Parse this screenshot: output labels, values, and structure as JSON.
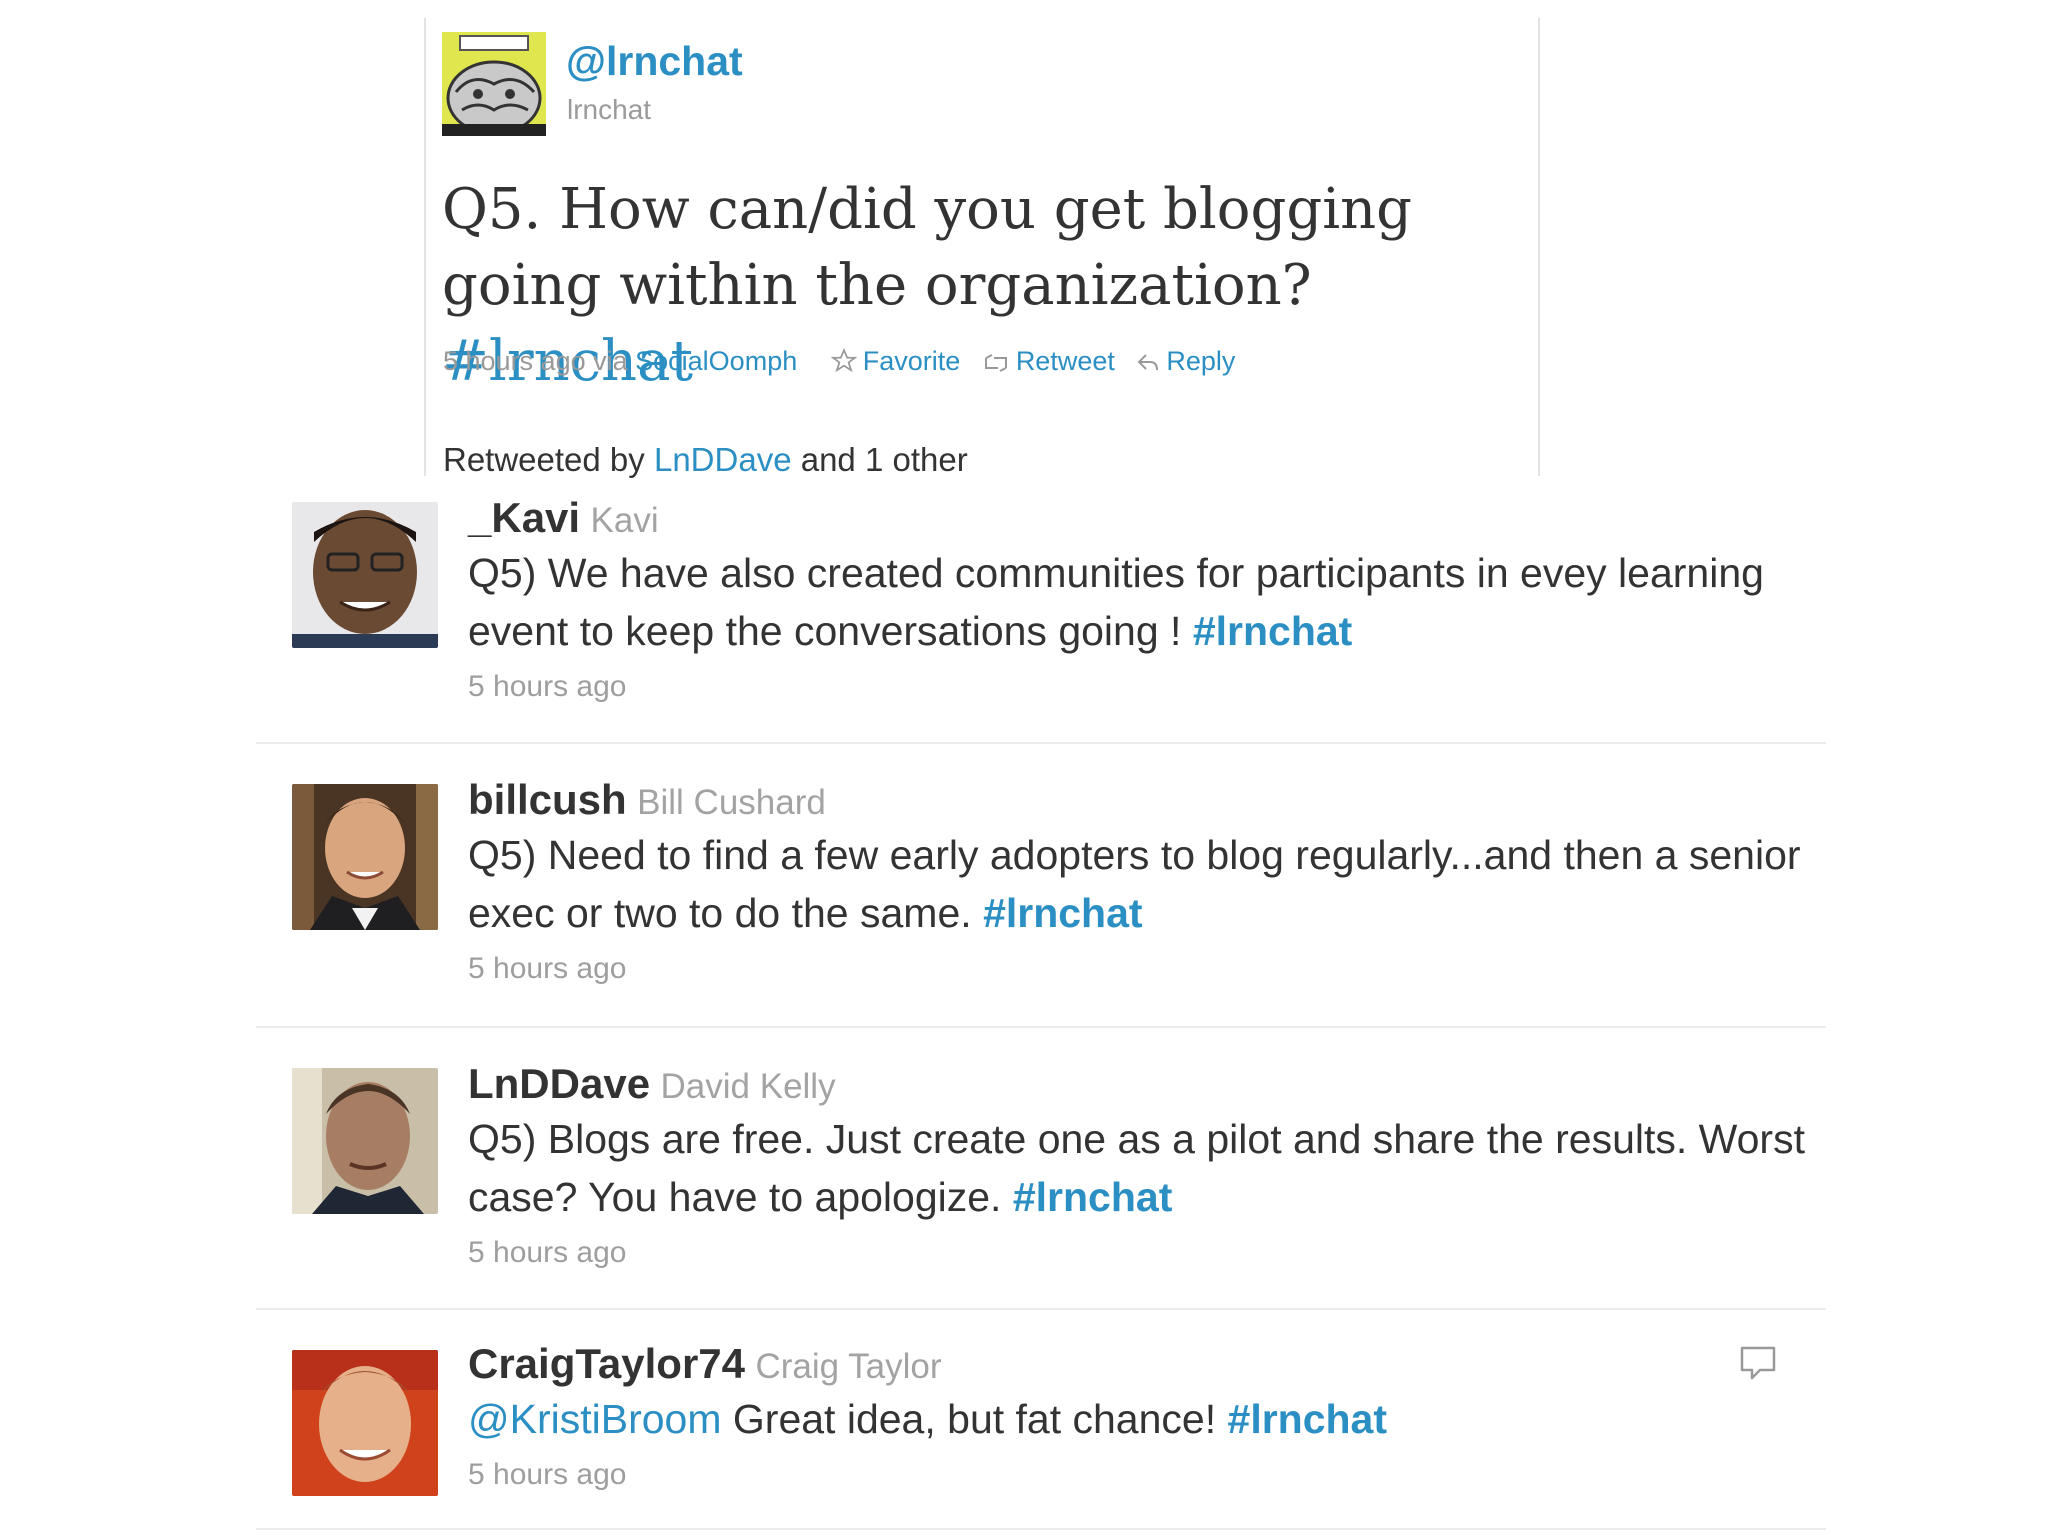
{
  "featured": {
    "handle": "@lrnchat",
    "name": "lrnchat",
    "text": "Q5. How can/did you get blogging going within the organization?",
    "hashtag": "#lrnchat",
    "time": "5 hours ago via",
    "source": "SocialOomph",
    "actions": {
      "favorite": "Favorite",
      "retweet": "Retweet",
      "reply": "Reply"
    },
    "retweeted_prefix": "Retweeted by",
    "retweeted_user": "LnDDave",
    "retweeted_suffix": "and 1 other"
  },
  "tweets": [
    {
      "user": "_Kavi",
      "name": "Kavi",
      "text": "Q5) We have also created communities for participants in evey learning event to keep the conversations going !",
      "hashtag": "#lrnchat",
      "time": "5 hours ago"
    },
    {
      "user": "billcush",
      "name": "Bill Cushard",
      "text": "Q5) Need to find a few early adopters to blog regularly...and then a senior exec or two to do the same.",
      "hashtag": "#lrnchat",
      "time": "5 hours ago"
    },
    {
      "user": "LnDDave",
      "name": "David Kelly",
      "text": "Q5) Blogs are free. Just create one as a pilot and share the results. Worst case? You have to apologize.",
      "hashtag": "#lrnchat",
      "time": "5 hours ago"
    },
    {
      "user": "CraigTaylor74",
      "name": "Craig Taylor",
      "mention": "@KristiBroom",
      "text": "Great idea, but fat chance!",
      "hashtag": "#lrnchat",
      "time": "5 hours ago"
    }
  ],
  "colors": {
    "link": "#2b8fc3",
    "text": "#333333",
    "muted": "#9e9e9e"
  },
  "icons": [
    "star-icon",
    "retweet-icon",
    "reply-arrow-icon",
    "speech-bubble-icon"
  ]
}
